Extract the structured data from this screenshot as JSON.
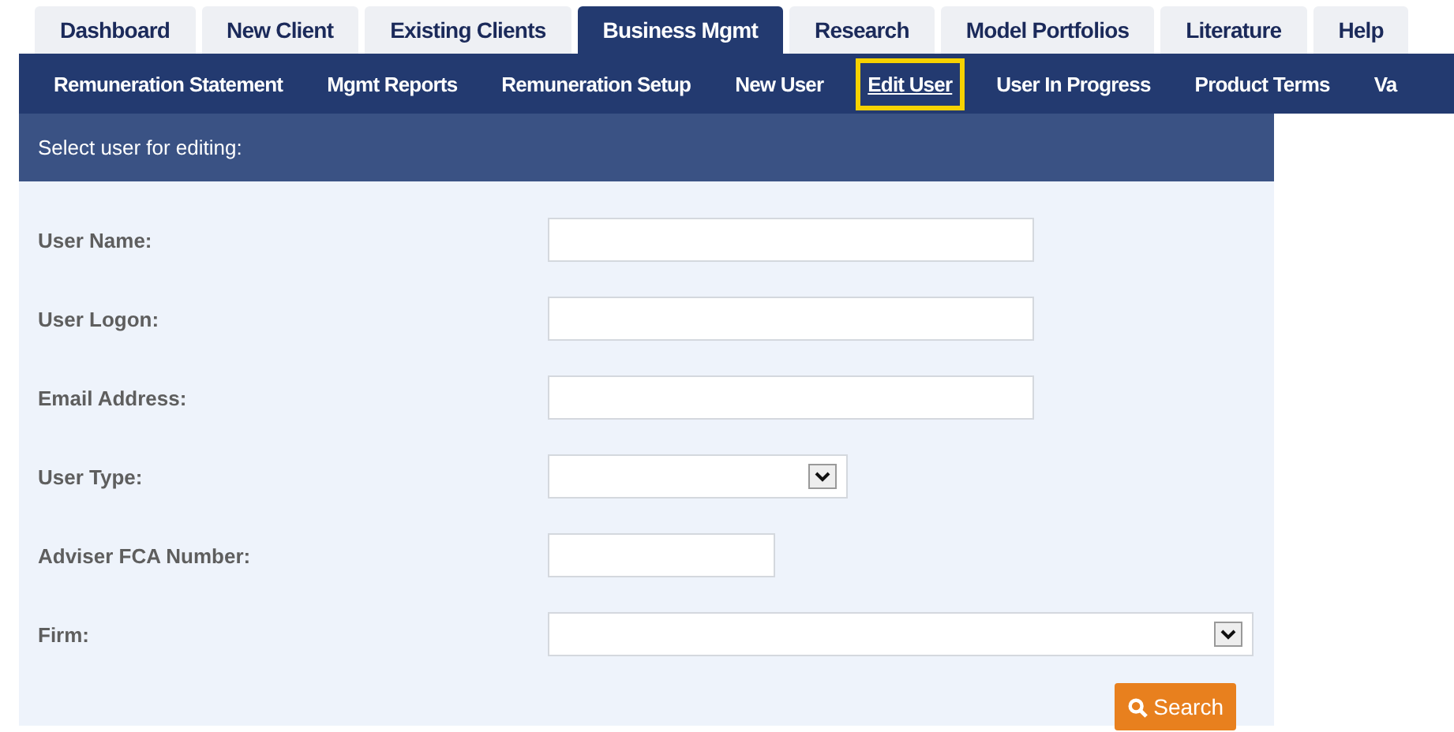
{
  "tabs": [
    {
      "label": "Dashboard",
      "selected": false
    },
    {
      "label": "New Client",
      "selected": false
    },
    {
      "label": "Existing Clients",
      "selected": false
    },
    {
      "label": "Business Mgmt",
      "selected": true
    },
    {
      "label": "Research",
      "selected": false
    },
    {
      "label": "Model Portfolios",
      "selected": false
    },
    {
      "label": "Literature",
      "selected": false
    },
    {
      "label": "Help",
      "selected": false
    }
  ],
  "subnav": [
    {
      "label": "Remuneration Statement",
      "selected": false,
      "highlighted": false
    },
    {
      "label": "Mgmt Reports",
      "selected": false,
      "highlighted": false
    },
    {
      "label": "Remuneration Setup",
      "selected": false,
      "highlighted": false
    },
    {
      "label": "New User",
      "selected": false,
      "highlighted": false
    },
    {
      "label": "Edit User",
      "selected": true,
      "highlighted": true
    },
    {
      "label": "User In Progress",
      "selected": false,
      "highlighted": false
    },
    {
      "label": "Product Terms",
      "selected": false,
      "highlighted": false
    },
    {
      "label": "Va",
      "selected": false,
      "highlighted": false
    }
  ],
  "panel": {
    "title": "Select user for editing:",
    "fields": [
      {
        "label": "User Name:",
        "kind": "text"
      },
      {
        "label": "User Logon:",
        "kind": "text"
      },
      {
        "label": "Email Address:",
        "kind": "text"
      },
      {
        "label": "User Type:",
        "kind": "select"
      },
      {
        "label": "Adviser FCA Number:",
        "kind": "text"
      },
      {
        "label": "Firm:",
        "kind": "select"
      }
    ],
    "search_button": "Search"
  }
}
